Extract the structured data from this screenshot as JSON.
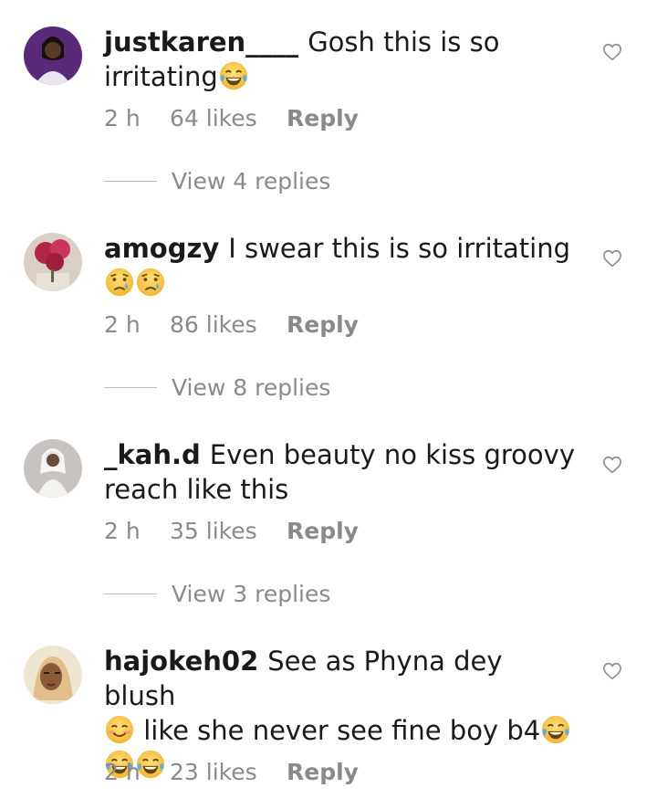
{
  "comments": [
    {
      "username": "justkaren____",
      "text": "Gosh this is so irritating",
      "emojis_inline": [
        "face-with-tears-of-joy"
      ],
      "time": "2 h",
      "likes": "64 likes",
      "reply_label": "Reply",
      "view_replies": "View 4 replies"
    },
    {
      "username": "amogzy",
      "text": "I swear this is so irritating",
      "emojis_after": [
        "crying-face",
        "crying-face"
      ],
      "time": "2 h",
      "likes": "86 likes",
      "reply_label": "Reply",
      "view_replies": "View 8 replies"
    },
    {
      "username": "_kah.d",
      "text": "Even beauty no kiss groovy reach like this",
      "time": "2 h",
      "likes": "35 likes",
      "reply_label": "Reply",
      "view_replies": "View 3 replies"
    },
    {
      "username": "hajokeh02",
      "text_part1": "See as Phyna dey blush",
      "text_part2": "like she never see fine boy b4",
      "emojis": [
        "smiling-face",
        "face-with-tears-of-joy",
        "face-with-tears-of-joy",
        "face-with-tears-of-joy"
      ],
      "time": "2 h",
      "likes": "23 likes",
      "reply_label": "Reply"
    }
  ],
  "icons": {
    "like": "heart-outline-icon"
  },
  "colors": {
    "meta_text": "#8a8a8a",
    "emoji_yellow": "#f5c13b"
  }
}
